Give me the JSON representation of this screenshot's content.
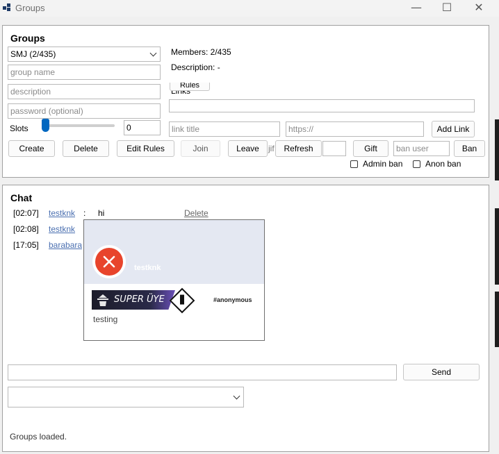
{
  "window": {
    "title": "Groups",
    "minimize": "—",
    "maximize": "☐",
    "close": "✕"
  },
  "groups": {
    "heading": "Groups",
    "selected_group": "SMJ (2/435)",
    "group_name_placeholder": "group name",
    "description_placeholder": "description",
    "password_placeholder": "password (optional)",
    "slots_label": "Slots",
    "slots_value": "0",
    "slider_level": 0,
    "members": "Members: 2/435",
    "description_text": "Description: -",
    "links_label": "Links",
    "rules_button": "Rules",
    "link_title_placeholder": "link title",
    "link_url_placeholder": "https://",
    "add_link_button": "Add Link",
    "buttons": {
      "create": "Create",
      "delete": "Delete",
      "edit_rules": "Edit Rules",
      "join": "Join",
      "leave": "Leave",
      "gif_fragment": "jif",
      "refresh": "Refresh",
      "gift": "Gift",
      "ban": "Ban"
    },
    "ban_user_placeholder": "ban user",
    "admin_ban_label": "Admin ban",
    "anon_ban_label": "Anon ban"
  },
  "chat": {
    "heading": "Chat",
    "messages": [
      {
        "time": "[02:07]",
        "user": "testknk",
        "sep": ":",
        "text": "hi",
        "action": "Delete"
      },
      {
        "time": "[02:08]",
        "user": "testknk"
      },
      {
        "time": "[17:05]",
        "user": "barabara"
      }
    ],
    "profile_card": {
      "username": "testknk",
      "badge_text": "SUPER ÜYE",
      "tag": "#anonymous",
      "bio": "testing",
      "banner_color": "#e4e8f2",
      "avatar_color": "#e8442c"
    },
    "send_button": "Send",
    "message_value": "",
    "dropdown_value": ""
  },
  "status": {
    "text": "Groups loaded."
  },
  "colors": {
    "accent": "#0067c0",
    "link": "#4a6fb0"
  }
}
